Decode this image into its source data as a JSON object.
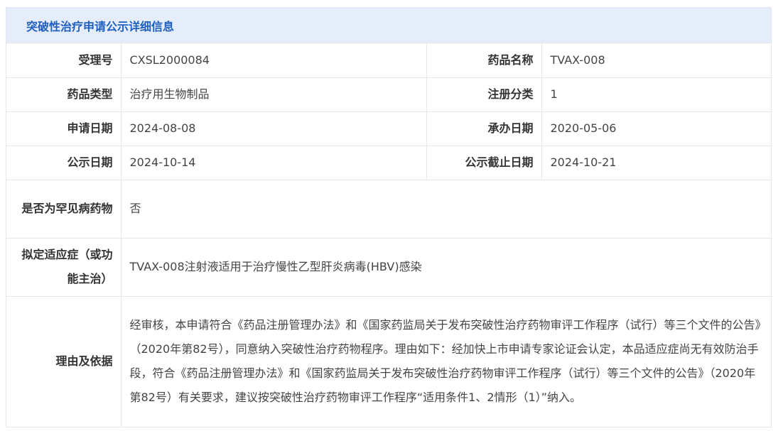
{
  "panel": {
    "title": "突破性治疗申请公示详细信息"
  },
  "rows": {
    "accept_no": {
      "label": "受理号",
      "value": "CXSL2000084"
    },
    "drug_name": {
      "label": "药品名称",
      "value": "TVAX-008"
    },
    "drug_type": {
      "label": "药品类型",
      "value": "治疗用生物制品"
    },
    "reg_class": {
      "label": "注册分类",
      "value": "1"
    },
    "apply_date": {
      "label": "申请日期",
      "value": "2024-08-08"
    },
    "handle_date": {
      "label": "承办日期",
      "value": "2020-05-06"
    },
    "publish_date": {
      "label": "公示日期",
      "value": "2024-10-14"
    },
    "publish_end_date": {
      "label": "公示截止日期",
      "value": "2024-10-21"
    },
    "rare_disease": {
      "label": "是否为罕见病药物",
      "value": "否"
    },
    "indication": {
      "label": "拟定适应症（或功能主治）",
      "value": "TVAX-008注射液适用于治疗慢性乙型肝炎病毒(HBV)感染"
    },
    "reason": {
      "label": "理由及依据",
      "value": "经审核，本申请符合《药品注册管理办法》和《国家药监局关于发布突破性治疗药物审评工作程序（试行）等三个文件的公告》（2020年第82号），同意纳入突破性治疗药物程序。理由如下：经加快上市申请专家论证会认定，本品适应症尚无有效防治手段，符合《药品注册管理办法》和《国家药监局关于发布突破性治疗药物审评工作程序（试行）等三个文件的公告》（2020年第82号）有关要求，建议按突破性治疗药物审评工作程序“适用条件1、2情形（1）”纳入。"
    }
  }
}
